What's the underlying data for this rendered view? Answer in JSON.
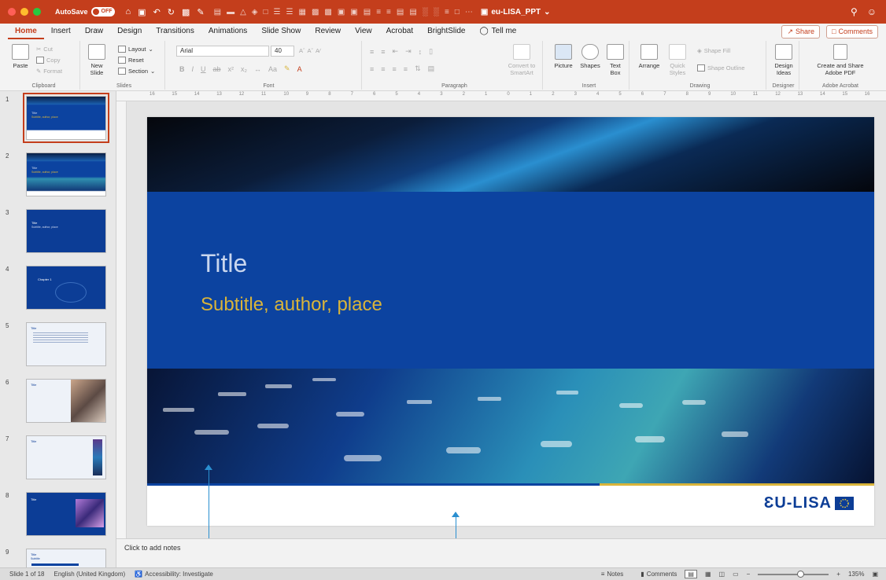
{
  "titlebar": {
    "autosave_label": "AutoSave",
    "autosave_state": "OFF",
    "doc_title": "eu-LISA_PPT",
    "bg_color": "#c43e1c"
  },
  "tabs": [
    "Home",
    "Insert",
    "Draw",
    "Design",
    "Transitions",
    "Animations",
    "Slide Show",
    "Review",
    "View",
    "Acrobat",
    "BrightSlide"
  ],
  "tell_me": "Tell me",
  "share_label": "Share",
  "comments_label": "Comments",
  "ribbon": {
    "clipboard": {
      "paste": "Paste",
      "cut": "Cut",
      "copy": "Copy",
      "format": "Format",
      "label": "Clipboard"
    },
    "slides": {
      "new_slide_line1": "New",
      "new_slide_line2": "Slide",
      "layout": "Layout",
      "reset": "Reset",
      "section": "Section",
      "label": "Slides"
    },
    "font": {
      "name": "Arial",
      "size": "40",
      "label": "Font"
    },
    "paragraph": {
      "convert_line1": "Convert to",
      "convert_line2": "SmartArt",
      "label": "Paragraph"
    },
    "insert": {
      "picture": "Picture",
      "shapes": "Shapes",
      "text_line1": "Text",
      "text_line2": "Box",
      "label": "Insert"
    },
    "drawing": {
      "arrange": "Arrange",
      "quick_line1": "Quick",
      "quick_line2": "Styles",
      "shape_fill": "Shape Fill",
      "shape_outline": "Shape Outline",
      "label": "Drawing"
    },
    "designer": {
      "line1": "Design",
      "line2": "Ideas",
      "label": "Designer"
    },
    "acrobat": {
      "line1": "Create and Share",
      "line2": "Adobe PDF",
      "label": "Adobe Acrobat"
    }
  },
  "thumbnails": [
    {
      "num": "1",
      "title": "Title",
      "sub": "Subtitle, author, place"
    },
    {
      "num": "2",
      "title": "Title",
      "sub": "Subtitle, author, place"
    },
    {
      "num": "3",
      "title": "Title",
      "sub": "Subtitle, author, place"
    },
    {
      "num": "4",
      "title": "Chapter 1",
      "sub": ""
    },
    {
      "num": "5",
      "title": "Title",
      "sub": ""
    },
    {
      "num": "6",
      "title": "Title",
      "sub": ""
    },
    {
      "num": "7",
      "title": "Title",
      "sub": ""
    },
    {
      "num": "8",
      "title": "Title",
      "sub": ""
    },
    {
      "num": "9",
      "title": "Title",
      "sub": "Subtitle"
    }
  ],
  "ruler_numbers": [
    "16",
    "15",
    "14",
    "13",
    "12",
    "11",
    "10",
    "9",
    "8",
    "7",
    "6",
    "5",
    "4",
    "3",
    "2",
    "1",
    "0",
    "1",
    "2",
    "3",
    "4",
    "5",
    "6",
    "7",
    "8",
    "9",
    "10",
    "11",
    "12",
    "13",
    "14",
    "15",
    "16"
  ],
  "slide": {
    "title": "Title",
    "subtitle": "Subtitle, author, place",
    "logo_text": "ƐU-LISA",
    "colors": {
      "band": "#0c43a0",
      "gold": "#d9b43a",
      "title": "#c9d6ee"
    }
  },
  "notes_placeholder": "Click to add notes",
  "status": {
    "slide_of": "Slide 1 of 18",
    "language": "English (United Kingdom)",
    "accessibility": "Accessibility: Investigate",
    "notes": "Notes",
    "comments": "Comments",
    "zoom": "135%"
  }
}
